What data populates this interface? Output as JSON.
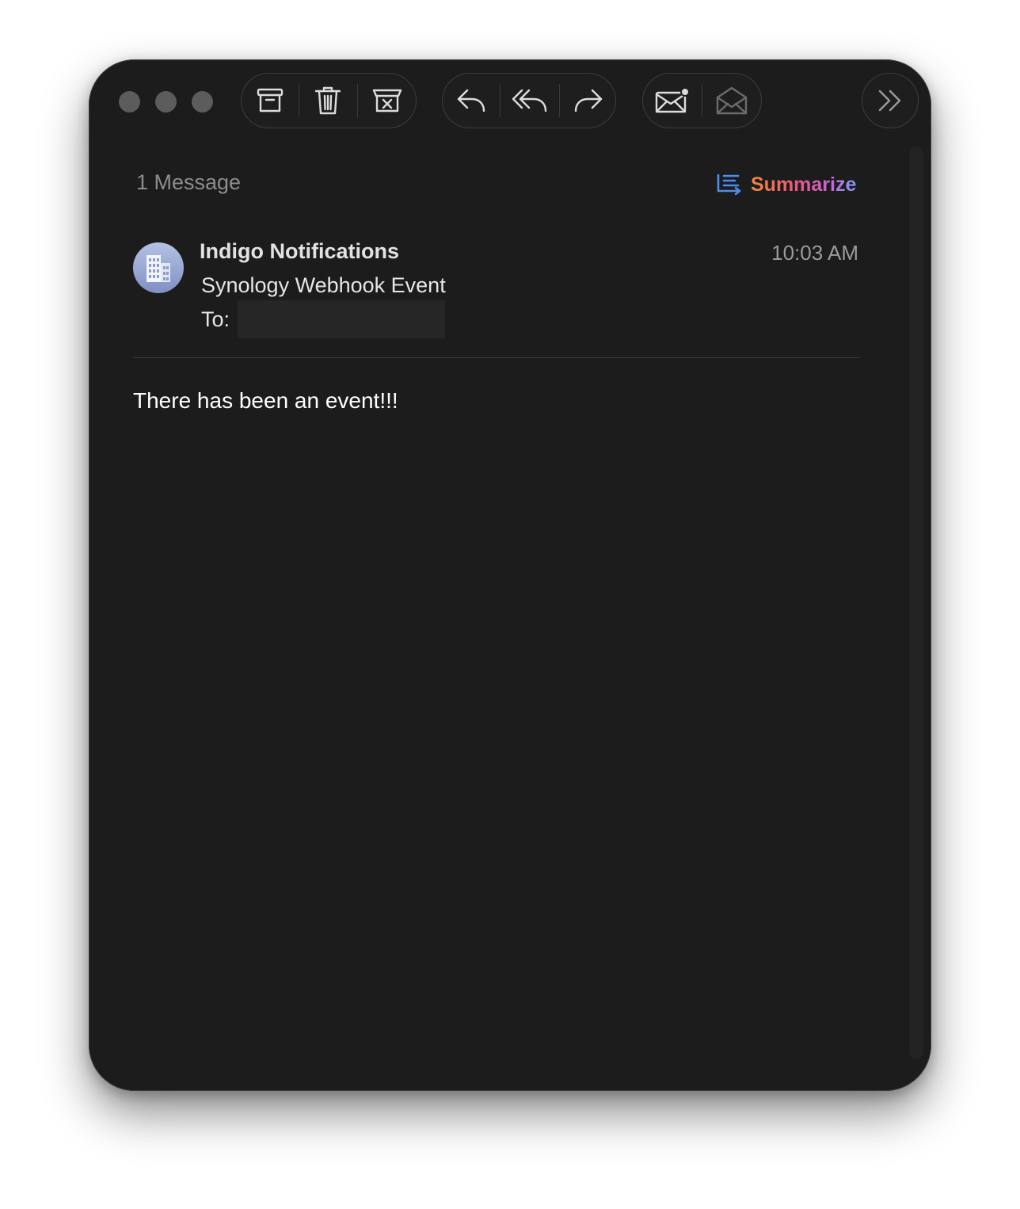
{
  "window": {
    "title": "1 Message"
  },
  "toolbar": {
    "groups": [
      {
        "name": "mailbox-actions",
        "buttons": [
          "archive-icon",
          "trash-icon",
          "junk-icon"
        ]
      },
      {
        "name": "reply-actions",
        "buttons": [
          "reply-icon",
          "reply-all-icon",
          "forward-icon"
        ]
      },
      {
        "name": "read-status",
        "buttons": [
          "mark-unread-icon",
          "mark-read-icon"
        ]
      },
      {
        "name": "overflow",
        "buttons": [
          "more-chevrons-icon"
        ]
      }
    ]
  },
  "header": {
    "message_count": "1 Message",
    "summarize_label": "Summarize"
  },
  "message": {
    "sender": "Indigo Notifications",
    "time": "10:03 AM",
    "subject": "Synology Webhook Event",
    "to_label": "To:",
    "body": "There has been an event!!!"
  },
  "colors": {
    "window_bg": "#1c1c1c",
    "avatar_gradient_top": "#b5c2e4",
    "avatar_gradient_bottom": "#7f90c4",
    "summarize_gradient": [
      "#f0883d",
      "#e9567f",
      "#c864d8",
      "#7f9cf0"
    ],
    "summarize_icon": "#4a8ef0"
  }
}
